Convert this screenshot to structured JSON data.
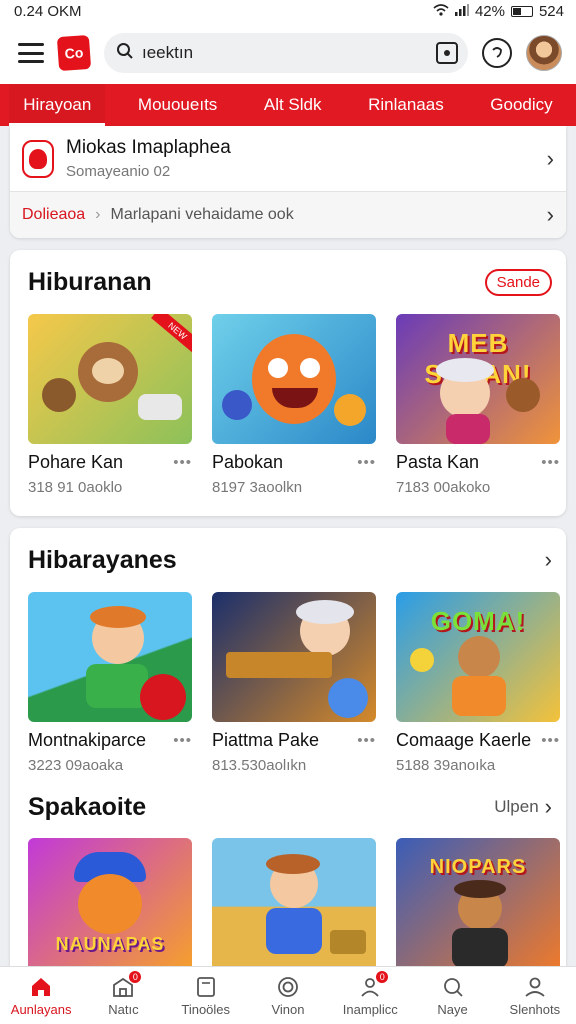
{
  "status": {
    "time": "0.24 OKM",
    "battery": "42%",
    "extra": "524"
  },
  "search": {
    "value": "ıeektın"
  },
  "tabs": [
    "Hirayoan",
    "Mououeıts",
    "Alt Sldk",
    "Rinlanaas",
    "Goodicy"
  ],
  "profile": {
    "title": "Miokas Imaplaphea",
    "subtitle": "Somayeanio 02",
    "crumb_red": "Dolieaoa",
    "crumb_text": "Marlapani vehaidame ook"
  },
  "sections": [
    {
      "title": "Hiburanan",
      "action": "Sande",
      "items": [
        {
          "name": "Pohare Kan",
          "sub": "318 91 0aoklo",
          "colors": [
            "#f5c84a",
            "#8cc15a"
          ],
          "icon": "bear-icon"
        },
        {
          "name": "Pabokan",
          "sub": "8197 3aoolkn",
          "colors": [
            "#6fd0ea",
            "#2b88c8"
          ],
          "icon": "monster-icon"
        },
        {
          "name": "Pasta Kan",
          "sub": "7183 00akoko",
          "colors": [
            "#6a3bb8",
            "#f0943a"
          ],
          "icon": "grandma-icon",
          "banner": "MEB SANAN!"
        }
      ]
    },
    {
      "title": "Hibarayanes",
      "action": "",
      "items": [
        {
          "name": "Montnakiparce",
          "sub": "3223 09aoaka",
          "colors": [
            "#5cc3f0",
            "#2b9a4a"
          ],
          "icon": "boy-icon"
        },
        {
          "name": "Piattma Pake",
          "sub": "813.530aolıkn",
          "colors": [
            "#1b2f6b",
            "#d58a2a"
          ],
          "icon": "grandma-sign-icon"
        },
        {
          "name": "Comaage Kaerle",
          "sub": "5188 39anoıka",
          "colors": [
            "#2a9de8",
            "#f4c23a"
          ],
          "icon": "kid-icon",
          "banner": "GOMA!"
        }
      ]
    },
    {
      "title": "Spakaoite",
      "action": "Ulpen",
      "items": [
        {
          "name": "",
          "sub": "",
          "colors": [
            "#c13ad8",
            "#f6a12a"
          ],
          "icon": "bear-hat-icon",
          "banner": "NAUNAPAS"
        },
        {
          "name": "",
          "sub": "",
          "colors": [
            "#79c4e8",
            "#e7b64a"
          ],
          "icon": "boy-jungle-icon"
        },
        {
          "name": "",
          "sub": "",
          "colors": [
            "#3a5db8",
            "#f07a2a"
          ],
          "icon": "kid-temple-icon",
          "banner": "NIOPARS"
        }
      ]
    }
  ],
  "nav": [
    {
      "label": "Aunlayans",
      "icon": "home-icon",
      "active": true
    },
    {
      "label": "Natıc",
      "icon": "chart-icon",
      "badge": "0"
    },
    {
      "label": "Tinoöles",
      "icon": "tablet-icon"
    },
    {
      "label": "Vinon",
      "icon": "circle-icon"
    },
    {
      "label": "Inamplicc",
      "icon": "person-icon",
      "badge": "0"
    },
    {
      "label": "Naye",
      "icon": "search-icon"
    },
    {
      "label": "Slenhots",
      "icon": "profile-icon"
    }
  ]
}
